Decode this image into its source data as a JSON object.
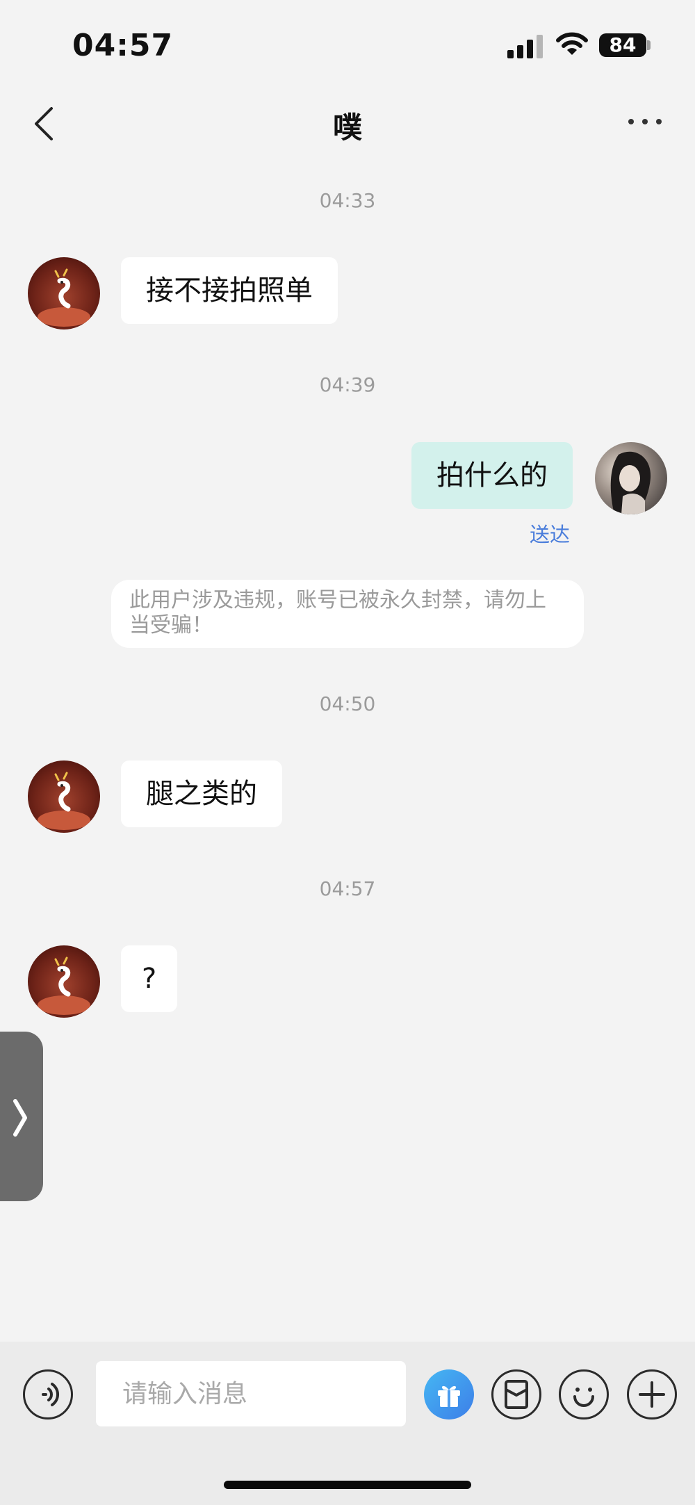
{
  "status_bar": {
    "time": "04:57",
    "battery": "84"
  },
  "header": {
    "title": "噗"
  },
  "messages": [
    {
      "timestamp": "04:33",
      "side": "left",
      "text": "接不接拍照单"
    },
    {
      "timestamp": "04:39",
      "side": "right",
      "text": "拍什么的",
      "status": "送达"
    },
    {
      "side": "system",
      "text": "此用户涉及违规，账号已被永久封禁，请勿上当受骗！"
    },
    {
      "timestamp": "04:50",
      "side": "left",
      "text": "腿之类的"
    },
    {
      "timestamp": "04:57",
      "side": "left",
      "text": "?"
    }
  ],
  "input": {
    "placeholder": "请输入消息",
    "value": ""
  },
  "icons": {
    "back": "chevron-left-icon",
    "more": "more-horizontal-icon",
    "voice": "voice-icon",
    "gift": "gift-icon",
    "red_packet": "red-packet-icon",
    "emoji": "emoji-icon",
    "plus": "plus-icon",
    "side_tab": "chevron-right-icon"
  },
  "colors": {
    "background": "#f3f3f3",
    "bubble_incoming": "#ffffff",
    "bubble_outgoing": "#d3f1ec",
    "delivered_text": "#4a7ddb",
    "gift_gradient_start": "#45b7f3",
    "gift_gradient_end": "#3d7ee8"
  }
}
